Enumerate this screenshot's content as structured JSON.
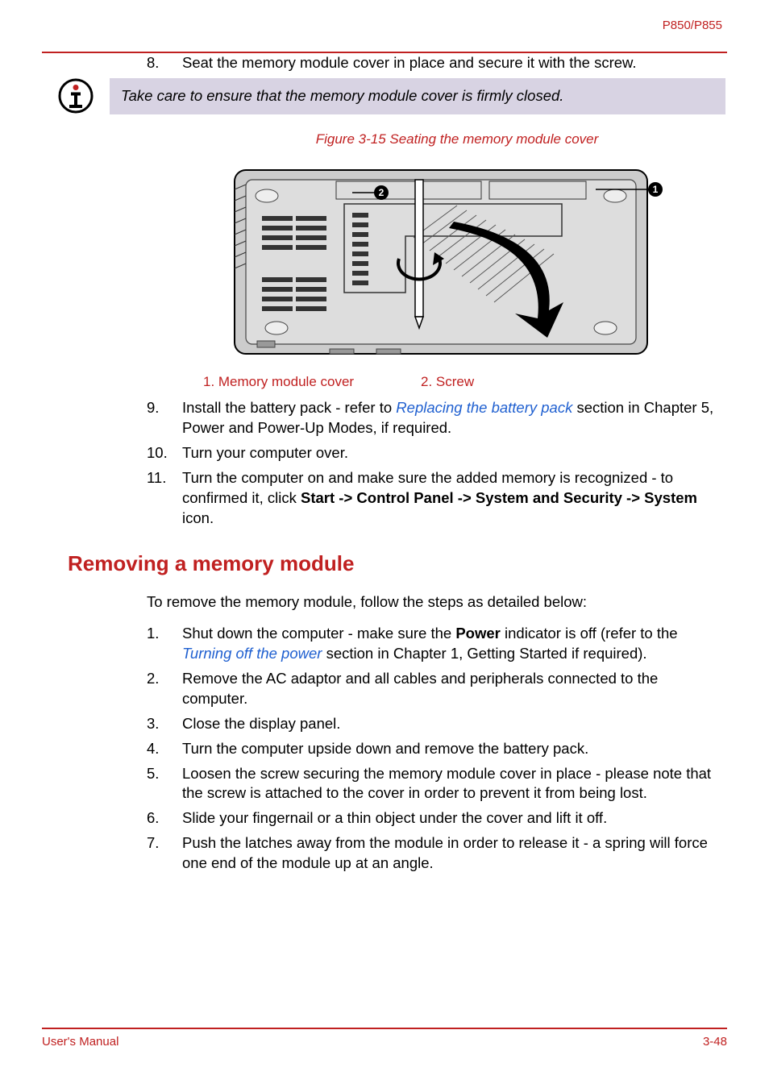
{
  "header": {
    "model": "P850/P855"
  },
  "step8": {
    "num": "8.",
    "text": "Seat the memory module cover in place and secure it with the screw."
  },
  "note": {
    "text": "Take care to ensure that the memory module cover is firmly closed."
  },
  "figure": {
    "caption": "Figure 3-15 Seating the memory module cover",
    "legend1": "1. Memory module cover",
    "legend2": "2. Screw"
  },
  "step9": {
    "num": "9.",
    "pre": "Install the battery pack - refer to ",
    "link": "Replacing the battery pack",
    "post": " section in Chapter 5, Power and Power-Up Modes, if required."
  },
  "step10": {
    "num": "10.",
    "text": "Turn your computer over."
  },
  "step11": {
    "num": "11.",
    "pre": "Turn the computer on and make sure the added memory is recognized - to confirmed it, click ",
    "bold": "Start -> Control Panel -> System and Security -> System",
    "post": " icon."
  },
  "section": {
    "title": "Removing a memory module",
    "intro": "To remove the memory module, follow the steps as detailed below:"
  },
  "r1": {
    "num": "1.",
    "pre": "Shut down the computer - make sure the ",
    "bold": "Power",
    "mid": " indicator is off (refer to the ",
    "link": "Turning off the power",
    "post": " section in Chapter 1, Getting Started if required)."
  },
  "r2": {
    "num": "2.",
    "text": "Remove the AC adaptor and all cables and peripherals connected to the computer."
  },
  "r3": {
    "num": "3.",
    "text": "Close the display panel."
  },
  "r4": {
    "num": "4.",
    "text": "Turn the computer upside down and remove the battery pack."
  },
  "r5": {
    "num": "5.",
    "text": "Loosen the screw securing the memory module cover in place - please note that the screw is attached to the cover in order to prevent it from being lost."
  },
  "r6": {
    "num": "6.",
    "text": "Slide your fingernail or a thin object under the cover and lift it off."
  },
  "r7": {
    "num": "7.",
    "text": "Push the latches away from the module in order to release it - a spring will force one end of the module up at an angle."
  },
  "footer": {
    "left": "User's Manual",
    "right": "3-48"
  }
}
